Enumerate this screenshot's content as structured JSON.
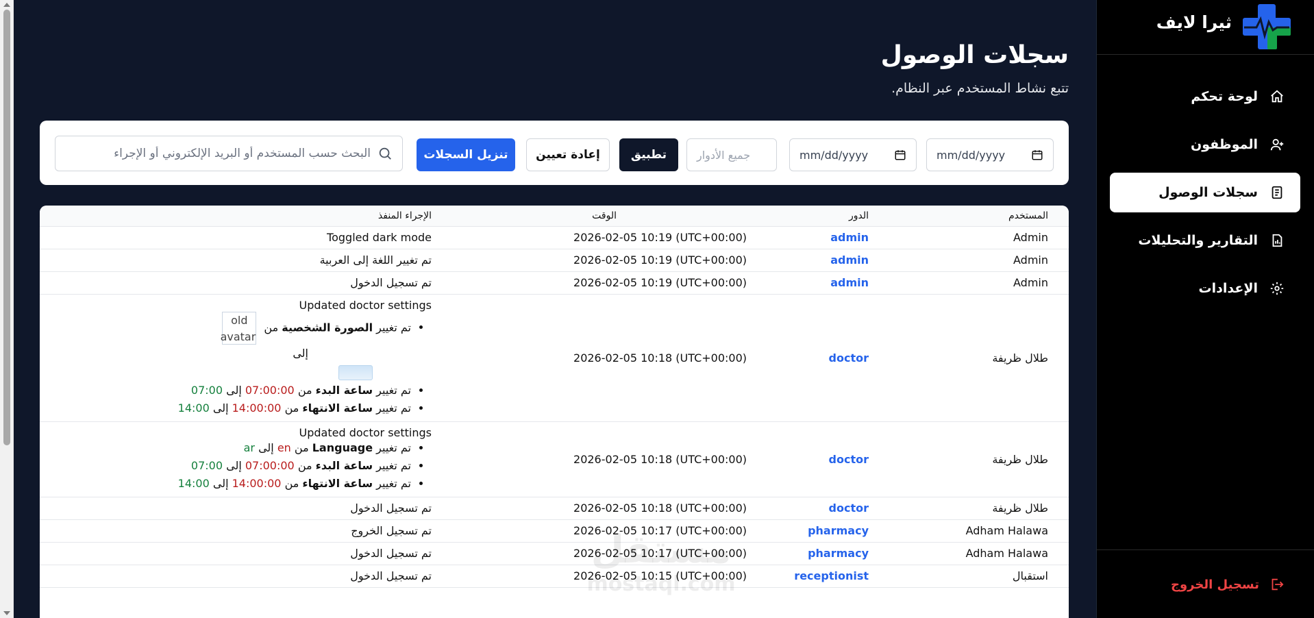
{
  "brand": {
    "name": "ثيرا لايف"
  },
  "nav": {
    "items": [
      {
        "label": "لوحة تحكم",
        "icon": "home-icon",
        "active": false
      },
      {
        "label": "الموظفون",
        "icon": "user-plus-icon",
        "active": false
      },
      {
        "label": "سجلات الوصول",
        "icon": "clipboard-icon",
        "active": true
      },
      {
        "label": "التقارير والتحليلات",
        "icon": "report-icon",
        "active": false
      },
      {
        "label": "الإعدادات",
        "icon": "gear-icon",
        "active": false
      }
    ],
    "logout": "تسجيل الخروج"
  },
  "header": {
    "title": "سجلات الوصول",
    "subtitle": "تتبع نشاط المستخدم عبر النظام."
  },
  "filters": {
    "date_from_placeholder": "mm/dd/yyyy",
    "date_to_placeholder": "mm/dd/yyyy",
    "role_value": "جميع الأدوار",
    "apply": "تطبيق",
    "reset": "إعادة تعيين",
    "download": "تنزيل السجلات",
    "search_placeholder": "البحث حسب المستخدم أو البريد الإلكتروني أو الإجراء"
  },
  "table": {
    "headers": {
      "user": "المستخدم",
      "role": "الدور",
      "time": "الوقت",
      "action": "الإجراء المنفذ"
    },
    "rows": [
      {
        "user": "Admin",
        "role": "admin",
        "time": "2026-02-05 10:19 (UTC+00:00)",
        "action": "Toggled dark mode"
      },
      {
        "user": "Admin",
        "role": "admin",
        "time": "2026-02-05 10:19 (UTC+00:00)",
        "action": "تم تغيير اللغة إلى العربية"
      },
      {
        "user": "Admin",
        "role": "admin",
        "time": "2026-02-05 10:19 (UTC+00:00)",
        "action": "تم تسجيل الدخول"
      },
      {
        "user": "طلال ظريفة",
        "role": "doctor",
        "time": "2026-02-05 10:18 (UTC+00:00)",
        "action": "Updated doctor settings",
        "changes": {
          "avatar_prefix": "تم تغيير",
          "avatar_field": "الصورة الشخصية",
          "from": "من",
          "avatar_alt": "old avatar",
          "to": "إلى",
          "start_prefix": "تم تغيير",
          "start_field": "ساعة البدء",
          "start_old": "07:00:00",
          "start_new": "07:00",
          "end_prefix": "تم تغيير",
          "end_field": "ساعة الانتهاء",
          "end_old": "14:00:00",
          "end_new": "14:00"
        }
      },
      {
        "user": "طلال ظريفة",
        "role": "doctor",
        "time": "2026-02-05 10:18 (UTC+00:00)",
        "action": "Updated doctor settings",
        "changes": {
          "lang_prefix": "تم تغيير",
          "lang_field": "Language",
          "from": "من",
          "lang_old": "en",
          "to": "إلى",
          "lang_new": "ar",
          "start_prefix": "تم تغيير",
          "start_field": "ساعة البدء",
          "start_old": "07:00:00",
          "start_new": "07:00",
          "end_prefix": "تم تغيير",
          "end_field": "ساعة الانتهاء",
          "end_old": "14:00:00",
          "end_new": "14:00"
        }
      },
      {
        "user": "طلال ظريفة",
        "role": "doctor",
        "time": "2026-02-05 10:18 (UTC+00:00)",
        "action": "تم تسجيل الدخول"
      },
      {
        "user": "Adham Halawa",
        "role": "pharmacy",
        "time": "2026-02-05 10:17 (UTC+00:00)",
        "action": "تم تسجيل الخروج"
      },
      {
        "user": "Adham Halawa",
        "role": "pharmacy",
        "time": "2026-02-05 10:17 (UTC+00:00)",
        "action": "تم تسجيل الدخول"
      },
      {
        "user": "استقبال",
        "role": "receptionist",
        "time": "2026-02-05 10:15 (UTC+00:00)",
        "action": "تم تسجيل الدخول"
      }
    ]
  },
  "watermark": {
    "text": "مستقل",
    "sub": "mostaql.com"
  }
}
